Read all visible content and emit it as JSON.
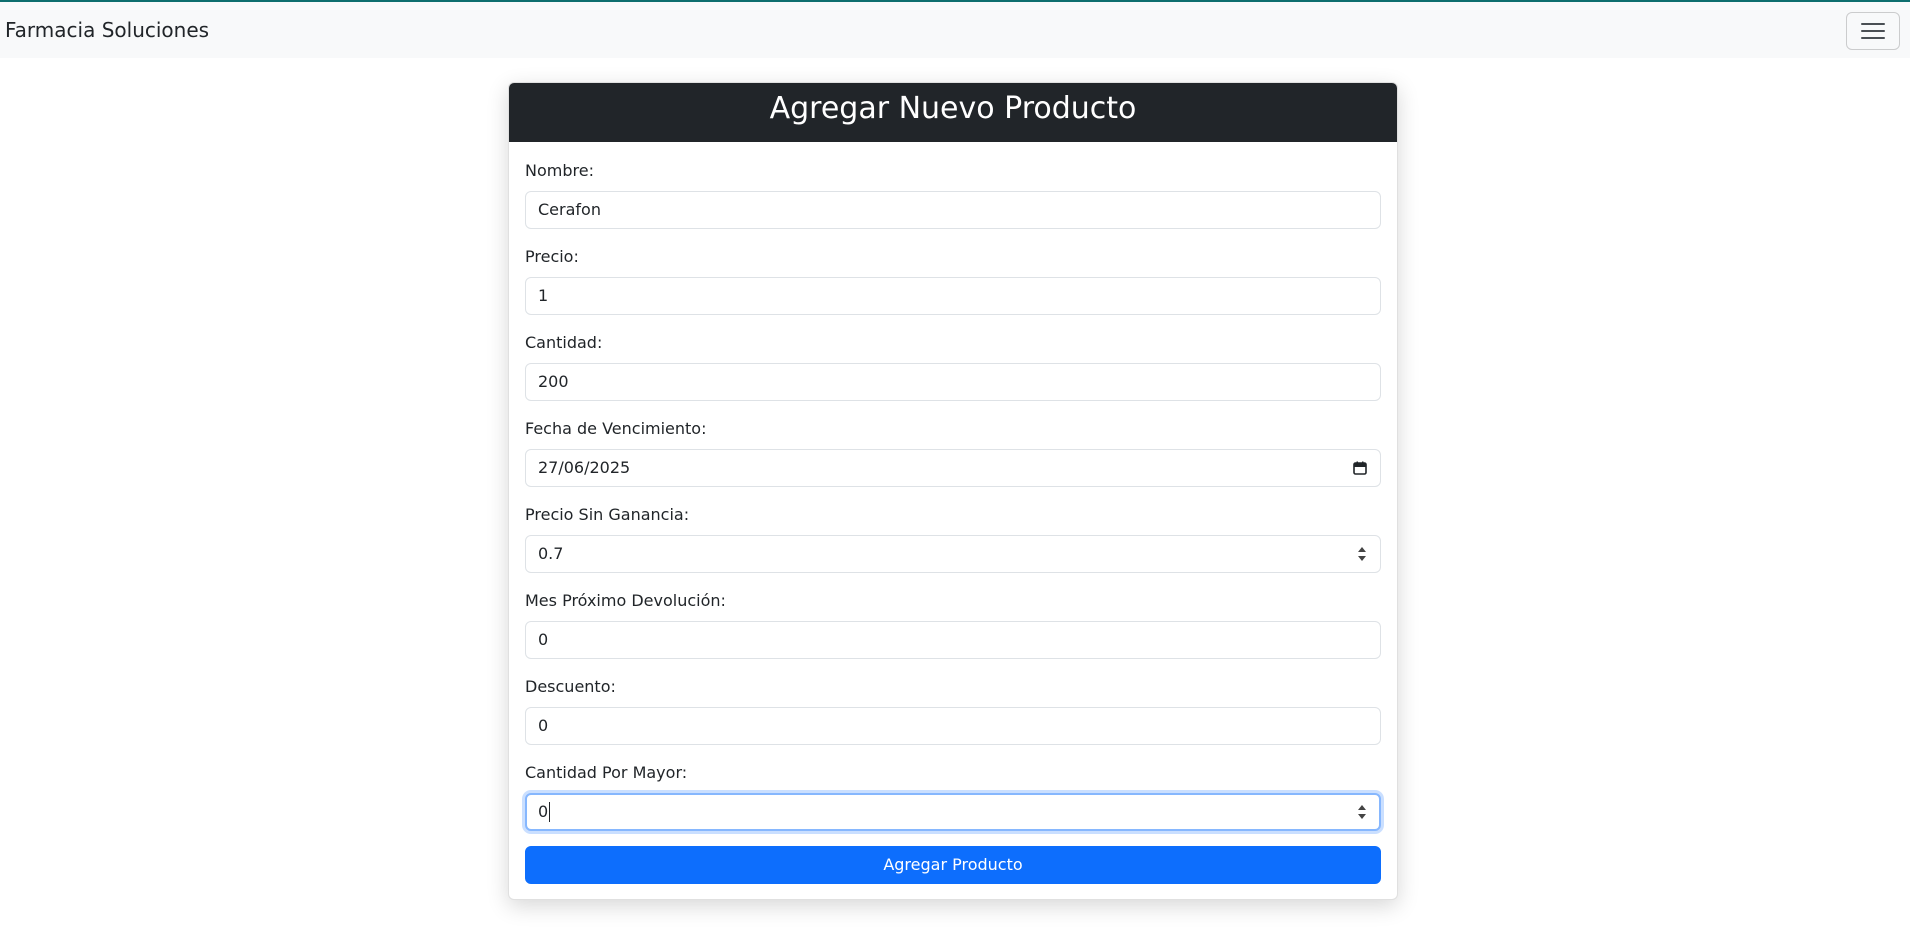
{
  "navbar": {
    "brand": "Farmacia Soluciones",
    "toggler_icon": "hamburger-menu-icon"
  },
  "form": {
    "title": "Agregar Nuevo Producto",
    "fields": [
      {
        "label": "Nombre:",
        "value": "Cerafon",
        "type": "text"
      },
      {
        "label": "Precio:",
        "value": "1",
        "type": "text"
      },
      {
        "label": "Cantidad:",
        "value": "200",
        "type": "text"
      },
      {
        "label": "Fecha de Vencimiento:",
        "value": "27/06/2025",
        "type": "date",
        "icon": "calendar-icon"
      },
      {
        "label": "Precio Sin Ganancia:",
        "value": "0.7",
        "type": "number",
        "icon": "spinner-arrows-icon"
      },
      {
        "label": "Mes Próximo Devolución:",
        "value": "0",
        "type": "text"
      },
      {
        "label": "Descuento:",
        "value": "0",
        "type": "text"
      },
      {
        "label": "Cantidad Por Mayor:",
        "value": "0",
        "type": "number",
        "icon": "spinner-arrows-icon",
        "focused": true
      }
    ],
    "submit_label": "Agregar Producto"
  },
  "colors": {
    "top_accent": "#0d6e6e",
    "navbar_bg": "#f8f9fa",
    "header_bg": "#212529",
    "primary": "#0d6efd",
    "focus_ring": "#86b7fe"
  }
}
